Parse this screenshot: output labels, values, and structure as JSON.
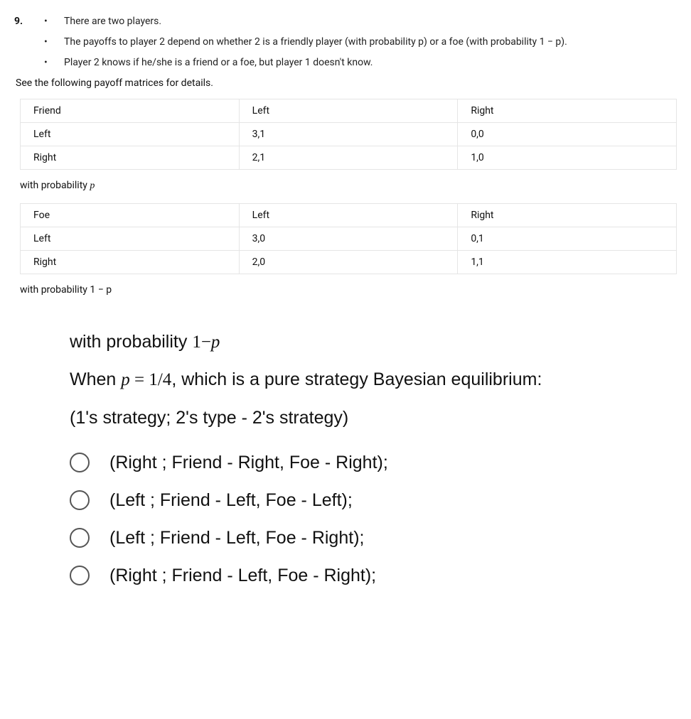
{
  "question": {
    "number": "9.",
    "bullets": [
      "There are two players.",
      "The payoffs to player 2 depend on whether 2 is a friendly player (with probability p) or a foe (with probability 1 − p).",
      "Player 2 knows if he/she is a friend or a foe, but player 1 doesn't know."
    ],
    "see_details": "See the following payoff matrices for details.",
    "table_friend": {
      "header": [
        "Friend",
        "Left",
        "Right"
      ],
      "rows": [
        [
          "Left",
          "3,1",
          "0,0"
        ],
        [
          "Right",
          "2,1",
          "1,0"
        ]
      ],
      "prob_label_prefix": "with probability ",
      "prob_label_var": "p"
    },
    "table_foe": {
      "header": [
        "Foe",
        "Left",
        "Right"
      ],
      "rows": [
        [
          "Left",
          "3,0",
          "0,1"
        ],
        [
          "Right",
          "2,0",
          "1,1"
        ]
      ],
      "prob_truncated": "with probability 1 − p"
    },
    "big_prob_prefix": "with probability ",
    "big_prob_expr": "1−p",
    "when_prefix": "When ",
    "when_expr": "p = 1/4",
    "when_suffix": ", which is a pure strategy Bayesian equilibrium:",
    "strategy_format": "(1's strategy; 2's type - 2's strategy)",
    "options": [
      "(Right ; Friend - Right, Foe - Right);",
      "(Left ; Friend - Left, Foe - Left);",
      "(Left ; Friend - Left, Foe - Right);",
      "(Right ; Friend - Left, Foe - Right);"
    ]
  }
}
